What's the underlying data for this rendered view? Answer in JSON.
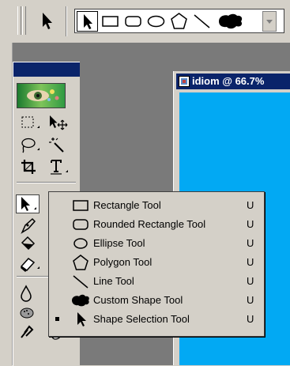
{
  "document": {
    "title": "idiom @ 66.7%"
  },
  "options_bar": {
    "shape_buttons": [
      "shape-selection",
      "rectangle",
      "rounded-rectangle",
      "ellipse",
      "polygon",
      "line",
      "custom-shape"
    ],
    "active": "shape-selection"
  },
  "colors": {
    "canvas": "#02a9f3",
    "title_bar": "#0a246a",
    "panel": "#d4d0c8",
    "workspace": "#7a7a7a"
  },
  "flyout": {
    "items": [
      {
        "label": "Rectangle Tool",
        "key": "U",
        "icon": "rectangle-icon",
        "selected": false
      },
      {
        "label": "Rounded Rectangle Tool",
        "key": "U",
        "icon": "rounded-rectangle-icon",
        "selected": false
      },
      {
        "label": "Ellipse Tool",
        "key": "U",
        "icon": "ellipse-icon",
        "selected": false
      },
      {
        "label": "Polygon Tool",
        "key": "U",
        "icon": "polygon-icon",
        "selected": false
      },
      {
        "label": "Line Tool",
        "key": "U",
        "icon": "line-icon",
        "selected": false
      },
      {
        "label": "Custom Shape Tool",
        "key": "U",
        "icon": "custom-shape-icon",
        "selected": false
      },
      {
        "label": "Shape Selection Tool",
        "key": "U",
        "icon": "arrow-icon",
        "selected": true
      }
    ]
  }
}
